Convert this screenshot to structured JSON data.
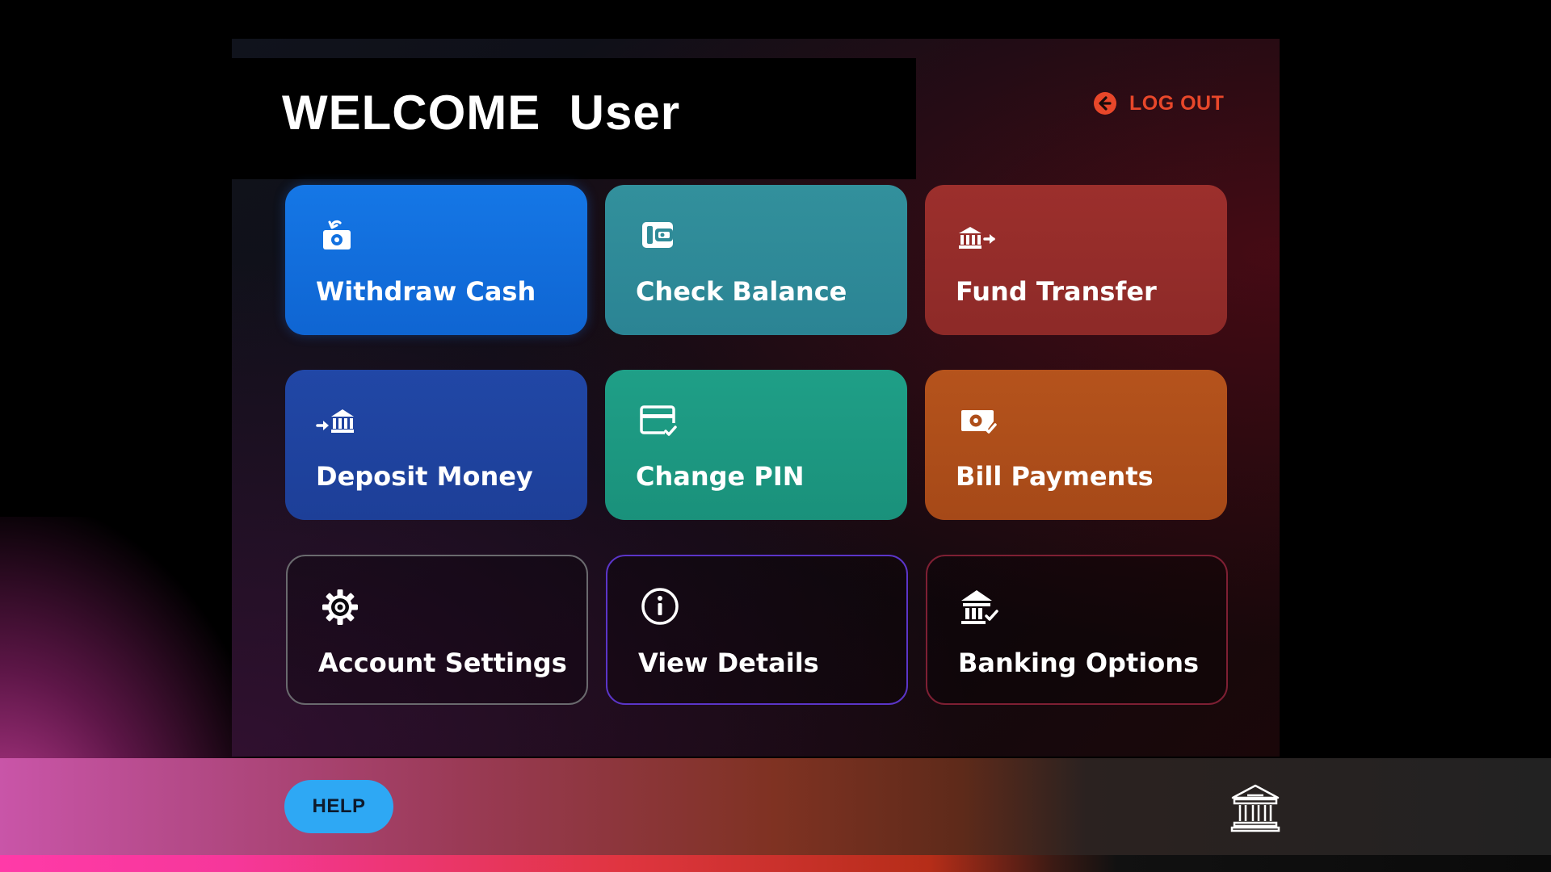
{
  "header": {
    "welcome_text": "WELCOME  User",
    "logout_label": "LOG OUT"
  },
  "menu": {
    "tiles": [
      {
        "label": "Withdraw Cash",
        "icon": "withdraw-cash-icon",
        "color": "#1471e0"
      },
      {
        "label": "Check Balance",
        "icon": "wallet-icon",
        "color": "#2f8b98"
      },
      {
        "label": "Fund Transfer",
        "icon": "bank-transfer-icon",
        "color": "#962d2a"
      },
      {
        "label": "Deposit Money",
        "icon": "bank-deposit-icon",
        "color": "#1f439f"
      },
      {
        "label": "Change PIN",
        "icon": "card-check-icon",
        "color": "#1d9882"
      },
      {
        "label": "Bill Payments",
        "icon": "bill-check-icon",
        "color": "#ae4e1a"
      },
      {
        "label": "Account Settings",
        "icon": "gear-icon",
        "color": "#6a6a6e"
      },
      {
        "label": "View Details",
        "icon": "info-icon",
        "color": "#5b35c8"
      },
      {
        "label": "Banking Options",
        "icon": "bank-check-icon",
        "color": "#7e1f33"
      }
    ]
  },
  "footer": {
    "help_label": "HELP",
    "logo_icon": "bank-icon",
    "help_color": "#2ea8f4"
  }
}
